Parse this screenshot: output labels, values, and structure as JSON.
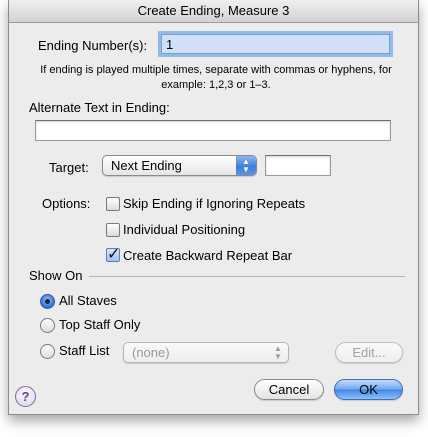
{
  "window": {
    "title": "Create Ending, Measure 3"
  },
  "ending_number": {
    "label": "Ending Number(s):",
    "value": "1",
    "help": "If ending is played multiple times, separate with commas or hyphens, for example: 1,2,3 or 1–3."
  },
  "alternate_text": {
    "label": "Alternate Text in Ending:",
    "value": ""
  },
  "target": {
    "label": "Target:",
    "selected": "Next Ending",
    "value": ""
  },
  "options": {
    "label": "Options:",
    "skip_ending": {
      "label": "Skip Ending if Ignoring Repeats",
      "checked": false
    },
    "individual_positioning": {
      "label": "Individual Positioning",
      "checked": false
    },
    "backward_repeat": {
      "label": "Create Backward Repeat Bar",
      "checked": true
    }
  },
  "show_on": {
    "label": "Show On",
    "all_staves": {
      "label": "All Staves",
      "selected": true
    },
    "top_staff": {
      "label": "Top Staff Only",
      "selected": false
    },
    "staff_list": {
      "label": "Staff List",
      "selected": false,
      "popup_value": "(none)",
      "edit_label": "Edit..."
    }
  },
  "buttons": {
    "help": "?",
    "cancel": "Cancel",
    "ok": "OK"
  },
  "icons": {
    "help": "question-icon",
    "checkmark": "checkmark-icon",
    "popup": "updown-arrows-icon"
  },
  "colors": {
    "accent": "#3f86ea",
    "focus": "#93b8ec",
    "help": "#5b3e9a"
  }
}
